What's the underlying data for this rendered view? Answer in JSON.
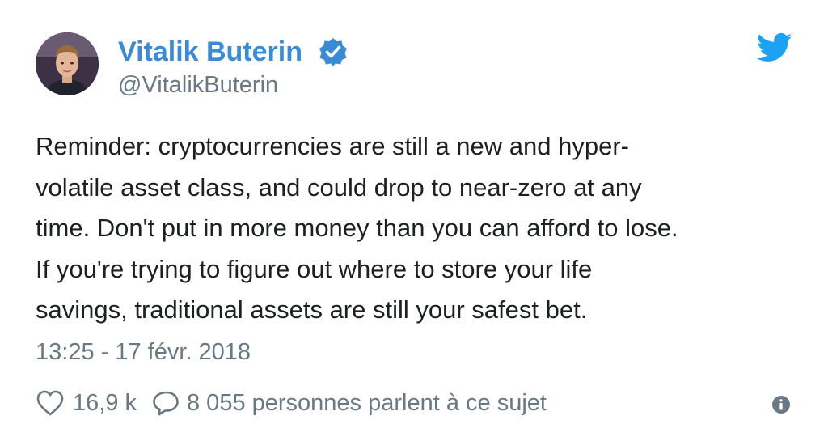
{
  "author": {
    "name": "Vitalik Buterin",
    "handle": "@VitalikButerin",
    "verified": true,
    "avatar_icon": "profile-avatar"
  },
  "brand": {
    "logo_icon": "twitter-bird-icon",
    "accent_color": "#1da1f2",
    "name_color": "#3a8ad6",
    "muted_color": "#697882"
  },
  "tweet": {
    "lines": [
      "Reminder: cryptocurrencies are still a new and hyper-",
      "volatile asset class, and could drop to near-zero at any",
      "time. Don't put in more money than you can afford to lose.",
      "If you're trying to figure out where to store your life",
      "savings, traditional assets are still your safest bet."
    ],
    "timestamp": "13:25 - 17 févr. 2018"
  },
  "actions": {
    "likes_icon": "heart-icon",
    "likes_count": "16,9 k",
    "conversation_icon": "speech-bubble-icon",
    "conversation_text": "8 055 personnes parlent à ce sujet",
    "info_icon": "info-icon"
  }
}
